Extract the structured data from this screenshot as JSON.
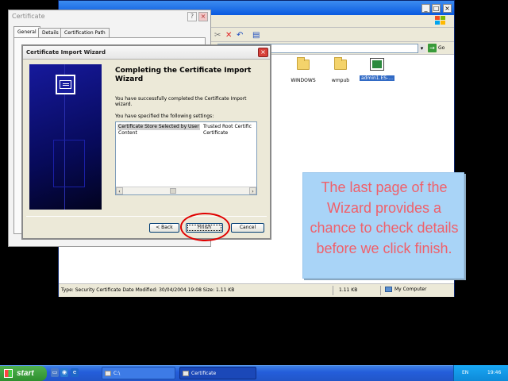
{
  "explorer": {
    "title": "",
    "toolbar_icons": [
      "move-to-icon",
      "delete-icon",
      "undo-icon",
      "views-icon"
    ],
    "address_value": "",
    "go_label": "Go",
    "files": [
      {
        "name": "WINDOWS",
        "icon": "folder-icon",
        "selected": false
      },
      {
        "name": "wmpub",
        "icon": "folder-icon",
        "selected": false
      },
      {
        "name": "admin1.ES-...",
        "icon": "certificate-file-icon",
        "selected": true
      }
    ],
    "status": {
      "details": "Type: Security Certificate Date Modified: 30/04/2004 19:08 Size: 1.11 KB",
      "size": "1.11 KB",
      "location": "My Computer"
    }
  },
  "certificate_window": {
    "title": "Certificate",
    "tabs": [
      "General",
      "Details",
      "Certification Path"
    ],
    "active_tab": "General"
  },
  "wizard": {
    "title": "Certificate Import Wizard",
    "heading": "Completing the Certificate Import Wizard",
    "description": "You have successfully completed the Certificate Import wizard.",
    "settings_label": "You have specified the following settings:",
    "settings": [
      {
        "key": "Certificate Store Selected by User",
        "value": "Trusted Root Certific"
      },
      {
        "key": "Content",
        "value": "Certificate"
      }
    ],
    "buttons": {
      "back": "< Back",
      "finish": "Finish",
      "cancel": "Cancel"
    }
  },
  "callout": {
    "text": "The last page of the Wizard provides a chance to check details before we click finish."
  },
  "taskbar": {
    "start_label": "start",
    "tasks": [
      {
        "label": "C:\\",
        "active": false
      },
      {
        "label": "Certificate",
        "active": true
      }
    ],
    "language": "EN",
    "clock": "19:46"
  },
  "colors": {
    "callout_bg": "#a9d4f7",
    "callout_text": "#f0606a",
    "highlight_ellipse": "#e00000",
    "wizard_banner": "#0b0e6e",
    "taskbar": "#245edb"
  }
}
